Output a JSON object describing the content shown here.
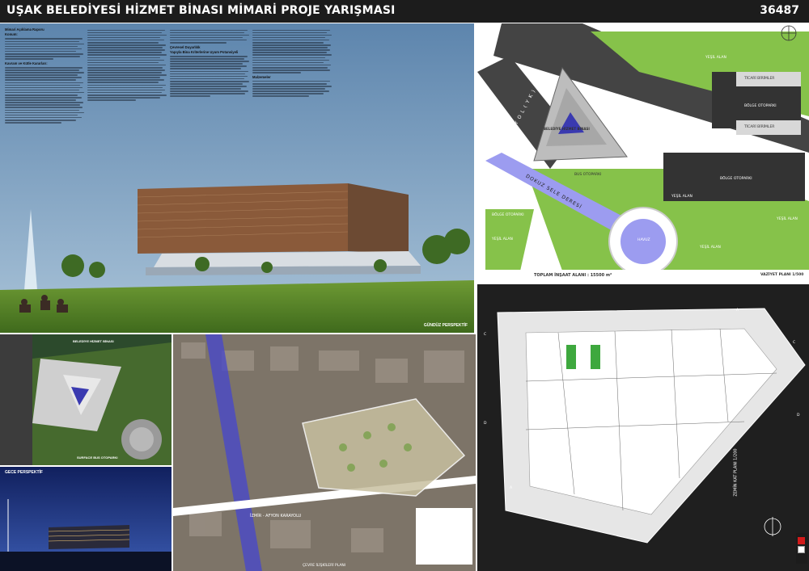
{
  "header": {
    "title": "UŞAK BELEDİYESİ HİZMET BİNASI MİMARİ PROJE YARIŞMASI",
    "code": "36487"
  },
  "report": {
    "heading": "Mimari Açıklama Raporu",
    "sub_konum": "Konum:",
    "sub_kavram": "Kavram ve Kütle Kararları:",
    "sub_cevresel": "Çevresel Duyarlılık",
    "sub_yapi": "Yapıyla Bina Kriterlerine Uyum Potansiyeli",
    "sub_malzeme": "Malzemeler"
  },
  "render": {
    "caption": "GÜNDÜZ PERSPEKTİF"
  },
  "night": {
    "caption": "GECE PERSPEKTİF"
  },
  "site_plan": {
    "building_label": "BELEDİYE HİZMET BİNASI",
    "road_top": "Y O L ( Y K )",
    "road_side": "Y O L ( Y K )",
    "canal": "DOKUZ SELE DERESİ",
    "pool": "HAVUZ",
    "caption": "TOPLAM İNŞAAT ALANI : 15500 m²",
    "scale": "VAZİYET PLANI 1/500",
    "green_labels": [
      "YEŞİL ALAN",
      "YEŞİL ALAN",
      "YEŞİL ALAN",
      "YEŞİL ALAN",
      "YEŞİL ALAN"
    ],
    "commercial_labels": [
      "TİCARİ BİRİMLER",
      "TİCARİ BİRİMLER"
    ],
    "parking_labels": [
      "BÖLGE OTOPARKI",
      "BÖLGE OTOPARKI",
      "BÖLGE OTOPARKI"
    ],
    "bus_label": "BUS OTOPARKI"
  },
  "plan": {
    "side_caption": "ZEMİN KAT PLANI 1/200",
    "section_marks": [
      "C",
      "C",
      "D",
      "D",
      "A",
      "A"
    ]
  },
  "aerial": {
    "caption_top": "BELEDİYE HİZMET BİNASI",
    "caption_bottom": "SURFACE BUS OTOPARKI"
  },
  "map": {
    "road_label": "İZMİR - AFYON KARAYOLU",
    "caption": "ÇEVRE İLİŞKİLERİ PLANI"
  },
  "colors": {
    "header_bg": "#1c1c1c",
    "sky": "#6f93b6",
    "grass": "#5a8a2a",
    "site_green": "#86c24a",
    "canal": "#9c9cf0",
    "plan_bg": "#1f1f1f",
    "accent_red": "#d21a1a"
  }
}
